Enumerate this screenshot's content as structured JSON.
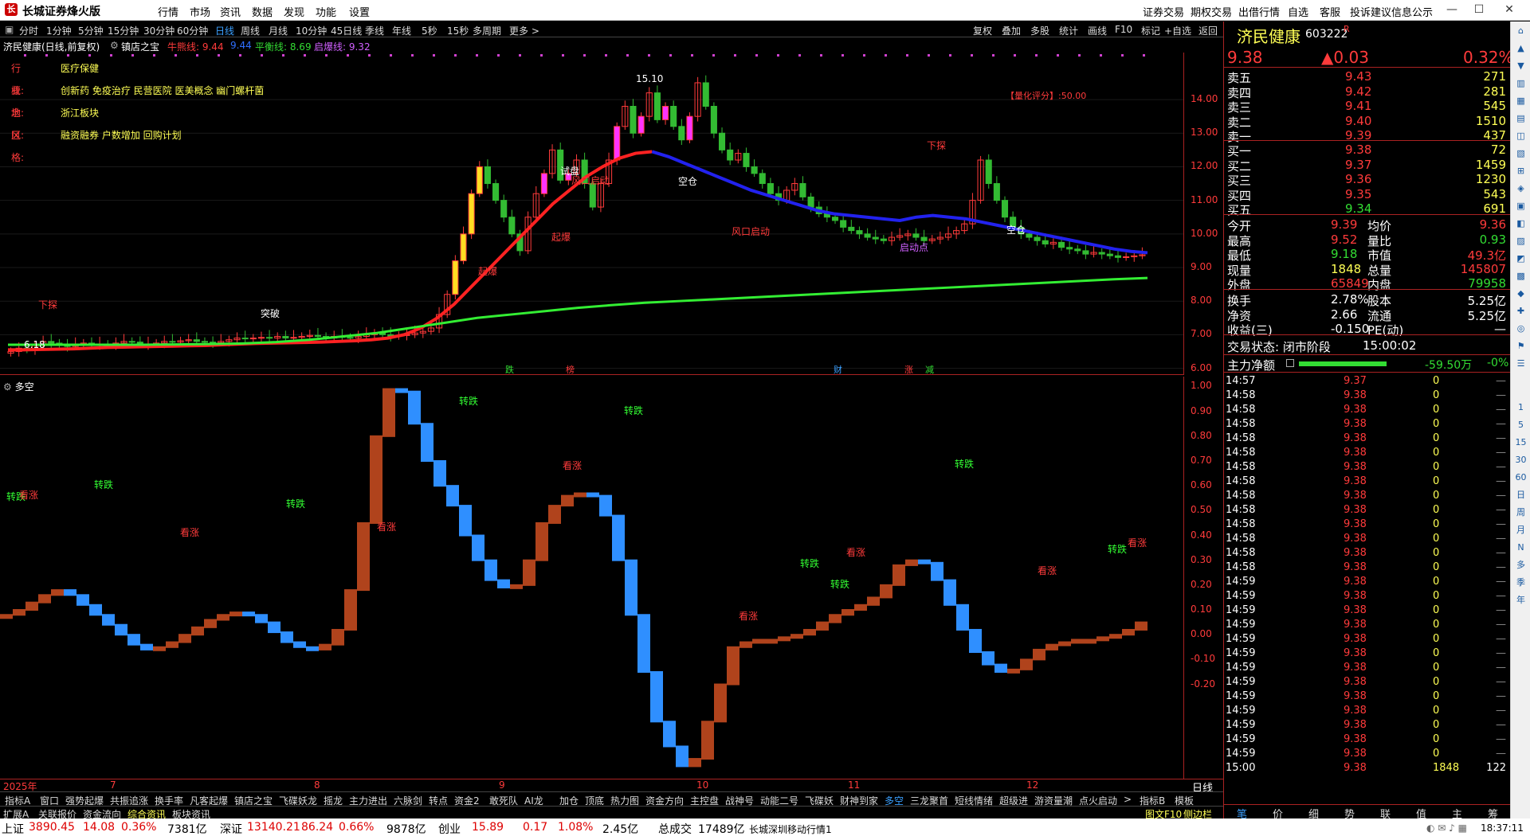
{
  "app": {
    "title": "长城证券烽火版",
    "logo": "logo-icon"
  },
  "menu": [
    "行情",
    "市场",
    "资讯",
    "数据",
    "发现",
    "功能",
    "设置"
  ],
  "right_links": [
    "证券交易",
    "期权交易",
    "出借行情",
    "自选",
    "客服",
    "投诉建议",
    "信息公示"
  ],
  "periods": [
    "分时",
    "1分钟",
    "5分钟",
    "15分钟",
    "30分钟",
    "60分钟",
    "日线",
    "周线",
    "月线",
    "10分钟",
    "45日线",
    "季线",
    "年线",
    "5秒",
    "15秒",
    "多周期",
    "更多 >"
  ],
  "active_period": "日线",
  "tools": [
    "复权",
    "叠加",
    "多股",
    "统计",
    "画线",
    "F10",
    "标记",
    "+自选",
    "返回"
  ],
  "info_row": {
    "name": "济民健康(日线,前复权)",
    "indicator": "镇店之宝",
    "line1": "牛熊线: 9.44",
    "line1b": "9.44",
    "line2": "平衡线: 8.69",
    "line3": "启爆线: 9.32"
  },
  "stock_info": [
    {
      "label": "行业:",
      "value": "医疗保健"
    },
    {
      "label": "概念:",
      "value": "创新药 免疫治疗 民营医院 医美概念 幽门螺杆菌"
    },
    {
      "label": "地区:",
      "value": "浙江板块"
    },
    {
      "label": "风格:",
      "value": "融资融券 户数增加 回购计划"
    }
  ],
  "quant_score": "【量化评分】:50.00",
  "annotations": {
    "peak": "15.10",
    "low": "6.18",
    "kongcang": "空仓",
    "shipan": "试盘",
    "qibao": "起爆",
    "fengkou": "风口启动",
    "xiatan": "下探",
    "qidongdian": "启动点",
    "tupo": "突破"
  },
  "main_axis": [
    "14.00",
    "13.00",
    "12.00",
    "11.00",
    "10.00",
    "9.00",
    "8.00",
    "7.00",
    "6.00"
  ],
  "events": [
    "跌",
    "榜",
    "财",
    "涨",
    "减"
  ],
  "sub_title": "多空",
  "sub_axis": [
    "1.00",
    "0.90",
    "0.80",
    "0.70",
    "0.60",
    "0.50",
    "0.40",
    "0.30",
    "0.20",
    "0.10",
    "0.00",
    "-0.10",
    "-0.20"
  ],
  "sub_labels": {
    "zhuandie": "转跌",
    "kanzhang": "看涨"
  },
  "dates": [
    "2025年",
    "7",
    "8",
    "9",
    "10",
    "11",
    "12"
  ],
  "date_mode": "日线",
  "tabs1": [
    "指标A",
    "窗口",
    "强势起爆",
    "共振追涨",
    "换手率",
    "凡客起爆",
    "镇店之宝",
    "飞碟妖龙",
    "摇龙",
    "主力进出",
    "六脉剑",
    "转点",
    "资金2",
    "敢死队",
    "AI龙",
    "加仓",
    "顶底",
    "热力图",
    "资金方向",
    "主控盘",
    "战神号",
    "动能二号",
    "飞碟妖",
    "财神到家",
    "多空",
    "三龙聚首",
    "短线情绪",
    "超级进",
    "游资量潮",
    "点火启动",
    ">",
    "指标B",
    "模板"
  ],
  "active_tab1": "多空",
  "tabs2": [
    "扩展A",
    "关联报价",
    "资金流向",
    "综合资讯",
    "板块资讯"
  ],
  "active_tab2": "综合资讯",
  "tabs2_right": [
    "图文F10",
    "侧边栏"
  ],
  "status": {
    "sh_label": "上证",
    "sh_val": "3890.45",
    "sh_chg": "14.08",
    "sh_pct": "0.36%",
    "sh_amt": "7381亿",
    "sz_label": "深证",
    "sz_val": "13140.21",
    "sz_chg": "86.24",
    "sz_pct": "0.66%",
    "sz_amt": "9878亿",
    "cy_label": "创业",
    "cy_val": "15.89",
    "cy_chg": "0.17",
    "cy_pct": "1.08%",
    "cy_amt": "2.45亿",
    "total_label": "总成交",
    "total_val": "17489亿",
    "conn": "长城深圳移动行情1",
    "time": "18:37:11"
  },
  "quote": {
    "name": "济民健康",
    "code": "603222",
    "tag": "R",
    "price": "9.38",
    "change": "▲0.03",
    "pct": "0.32%",
    "asks": [
      [
        "卖五",
        "9.43",
        "271"
      ],
      [
        "卖四",
        "9.42",
        "281"
      ],
      [
        "卖三",
        "9.41",
        "545"
      ],
      [
        "卖二",
        "9.40",
        "1510"
      ],
      [
        "卖一",
        "9.39",
        "437"
      ]
    ],
    "bids": [
      [
        "买一",
        "9.38",
        "72"
      ],
      [
        "买二",
        "9.37",
        "1459"
      ],
      [
        "买三",
        "9.36",
        "1230"
      ],
      [
        "买四",
        "9.35",
        "543"
      ],
      [
        "买五",
        "9.34",
        "691"
      ]
    ],
    "stats": [
      [
        "今开",
        "9.39",
        "均价",
        "9.36"
      ],
      [
        "最高",
        "9.52",
        "量比",
        "0.93"
      ],
      [
        "最低",
        "9.18",
        "市值",
        "49.3亿"
      ],
      [
        "现量",
        "1848",
        "总量",
        "145807"
      ],
      [
        "外盘",
        "65849",
        "内盘",
        "79958"
      ]
    ],
    "stats2": [
      [
        "换手",
        "2.78%",
        "股本",
        "5.25亿"
      ],
      [
        "净资",
        "2.66",
        "流通",
        "5.25亿"
      ],
      [
        "收益(三)",
        "-0.150",
        "PE(动)",
        "—"
      ]
    ],
    "trade_status_label": "交易状态: 闭市阶段",
    "trade_time": "15:00:02",
    "main_net_label": "主力净额",
    "main_net": "-59.50万",
    "main_net_pct": "-0%"
  },
  "ticks": [
    [
      "14:57",
      "9.37",
      "0"
    ],
    [
      "14:58",
      "9.38",
      "0"
    ],
    [
      "14:58",
      "9.38",
      "0"
    ],
    [
      "14:58",
      "9.38",
      "0"
    ],
    [
      "14:58",
      "9.38",
      "0"
    ],
    [
      "14:58",
      "9.38",
      "0"
    ],
    [
      "14:58",
      "9.38",
      "0"
    ],
    [
      "14:58",
      "9.38",
      "0"
    ],
    [
      "14:58",
      "9.38",
      "0"
    ],
    [
      "14:58",
      "9.38",
      "0"
    ],
    [
      "14:58",
      "9.38",
      "0"
    ],
    [
      "14:58",
      "9.38",
      "0"
    ],
    [
      "14:58",
      "9.38",
      "0"
    ],
    [
      "14:58",
      "9.38",
      "0"
    ],
    [
      "14:59",
      "9.38",
      "0"
    ],
    [
      "14:59",
      "9.38",
      "0"
    ],
    [
      "14:59",
      "9.38",
      "0"
    ],
    [
      "14:59",
      "9.38",
      "0"
    ],
    [
      "14:59",
      "9.38",
      "0"
    ],
    [
      "14:59",
      "9.38",
      "0"
    ],
    [
      "14:59",
      "9.38",
      "0"
    ],
    [
      "14:59",
      "9.38",
      "0"
    ],
    [
      "14:59",
      "9.38",
      "0"
    ],
    [
      "14:59",
      "9.38",
      "0"
    ],
    [
      "14:59",
      "9.38",
      "0"
    ],
    [
      "14:59",
      "9.38",
      "0"
    ],
    [
      "14:59",
      "9.38",
      "0"
    ],
    [
      "15:00",
      "9.38",
      "1848",
      "122"
    ]
  ],
  "rp_tabs": [
    "笔",
    "价",
    "细",
    "势",
    "联",
    "值",
    "主",
    "筹"
  ],
  "sidebar_items": [
    "1",
    "5",
    "15",
    "30",
    "60",
    "日",
    "周",
    "月",
    "N",
    "多",
    "季",
    "年"
  ],
  "colors": {
    "up": "#ff3b3b",
    "down": "#33dd33",
    "accent": "#3ba0ff",
    "yellow": "#ffff55",
    "brown": "#b0431c",
    "blue_bar": "#2f8fff"
  },
  "chart_data": {
    "type": "candlestick",
    "price_ylim": [
      5.8,
      15.4
    ],
    "closes": [
      6.5,
      6.6,
      6.55,
      6.7,
      6.8,
      6.75,
      6.7,
      6.65,
      6.7,
      6.75,
      6.7,
      6.72,
      6.7,
      6.75,
      6.8,
      6.78,
      6.7,
      6.72,
      6.75,
      6.8,
      6.78,
      6.82,
      6.85,
      6.8,
      6.78,
      6.76,
      6.8,
      6.85,
      6.9,
      6.88,
      6.9,
      6.92,
      6.9,
      6.95,
      6.9,
      6.92,
      6.95,
      6.98,
      6.95,
      6.9,
      6.95,
      6.92,
      6.9,
      6.95,
      7.0,
      7.05,
      7.0,
      6.95,
      6.98,
      7.0,
      7.05,
      7.1,
      7.2,
      7.6,
      8.2,
      9.2,
      10.0,
      11.2,
      12.0,
      11.5,
      11.0,
      10.5,
      10.0,
      9.5,
      10.5,
      11.2,
      11.8,
      12.5,
      11.6,
      11.8,
      12.2,
      11.5,
      10.8,
      11.5,
      12.2,
      13.2,
      13.8,
      13.0,
      13.5,
      14.2,
      13.4,
      13.8,
      13.2,
      12.8,
      13.5,
      14.5,
      13.8,
      13.0,
      12.5,
      12.2,
      12.4,
      12.0,
      11.8,
      11.5,
      11.2,
      11.0,
      11.3,
      11.5,
      11.1,
      10.8,
      10.6,
      10.5,
      10.4,
      10.2,
      10.1,
      10.0,
      9.9,
      9.85,
      9.8,
      9.9,
      9.95,
      10.0,
      9.9,
      9.8,
      9.85,
      9.9,
      10.0,
      10.1,
      10.3,
      11.0,
      12.2,
      11.5,
      11.0,
      10.5,
      10.2,
      10.0,
      9.9,
      9.8,
      9.7,
      9.75,
      9.6,
      9.55,
      9.5,
      9.4,
      9.45,
      9.4,
      9.35,
      9.3,
      9.32,
      9.35,
      9.38
    ],
    "bull_bear_line": [
      6.55,
      6.55,
      6.56,
      6.57,
      6.58,
      6.6,
      6.62,
      6.63,
      6.64,
      6.65,
      6.66,
      6.67,
      6.68,
      6.7,
      6.72,
      6.74,
      6.75,
      6.76,
      6.77,
      6.78,
      6.8,
      6.82,
      6.85,
      6.9,
      7.0,
      7.2,
      7.5,
      7.9,
      8.4,
      8.9,
      9.4,
      9.9,
      10.4,
      10.9,
      11.3,
      11.7,
      12.0,
      12.25,
      12.4,
      12.45,
      12.3,
      12.1,
      11.9,
      11.7,
      11.5,
      11.3,
      11.15,
      11.0,
      10.85,
      10.7,
      10.6,
      10.55,
      10.5,
      10.45,
      10.4,
      10.5,
      10.55,
      10.5,
      10.45,
      10.35,
      10.25,
      10.15,
      10.05,
      9.95,
      9.85,
      9.75,
      9.65,
      9.55,
      9.48,
      9.44
    ],
    "balance_line": [
      6.7,
      6.7,
      6.7,
      6.7,
      6.7,
      6.71,
      6.72,
      6.74,
      6.78,
      6.85,
      6.95,
      7.05,
      7.2,
      7.35,
      7.5,
      7.6,
      7.7,
      7.8,
      7.88,
      7.95,
      8.0,
      8.05,
      8.1,
      8.15,
      8.2,
      8.25,
      8.3,
      8.35,
      8.4,
      8.45,
      8.5,
      8.55,
      8.6,
      8.65,
      8.69
    ],
    "duokong": [
      0.08,
      0.1,
      0.13,
      0.16,
      0.18,
      0.16,
      0.12,
      0.08,
      0.04,
      0.0,
      -0.04,
      -0.06,
      -0.05,
      -0.03,
      0.0,
      0.03,
      0.06,
      0.08,
      0.09,
      0.08,
      0.05,
      0.01,
      -0.03,
      -0.05,
      -0.06,
      -0.04,
      0.02,
      0.18,
      0.45,
      0.8,
      0.99,
      0.98,
      0.85,
      0.7,
      0.6,
      0.52,
      0.4,
      0.3,
      0.22,
      0.19,
      0.2,
      0.3,
      0.45,
      0.52,
      0.56,
      0.57,
      0.56,
      0.48,
      0.3,
      0.08,
      -0.15,
      -0.35,
      -0.45,
      -0.53,
      -0.5,
      -0.35,
      -0.2,
      -0.05,
      -0.03,
      -0.02,
      -0.02,
      -0.01,
      0.0,
      0.02,
      0.05,
      0.08,
      0.1,
      0.12,
      0.15,
      0.2,
      0.28,
      0.3,
      0.29,
      0.22,
      0.12,
      0.02,
      -0.07,
      -0.12,
      -0.15,
      -0.14,
      -0.1,
      -0.06,
      -0.04,
      -0.03,
      -0.02,
      -0.02,
      -0.01,
      0.0,
      0.02,
      0.05
    ]
  }
}
